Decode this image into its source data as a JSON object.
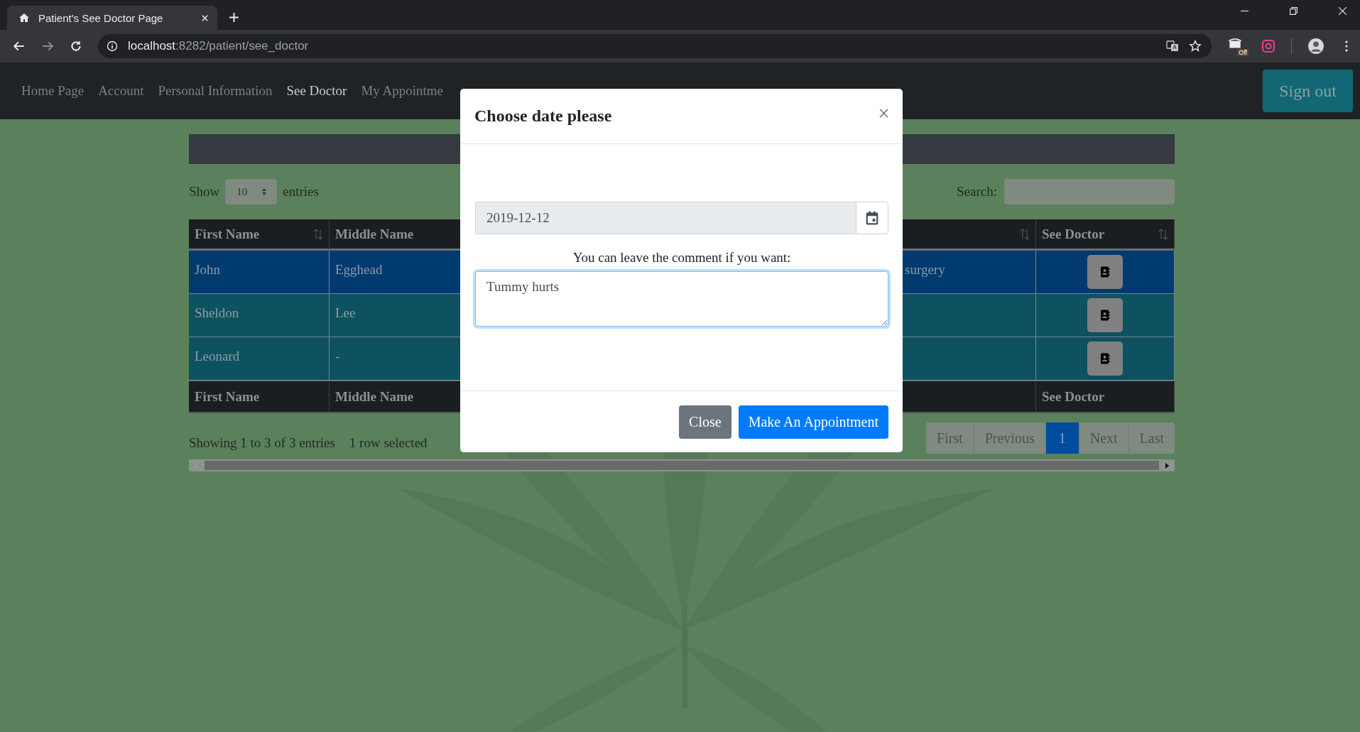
{
  "browser": {
    "tab_title": "Patient's See Doctor Page",
    "url_host": "localhost",
    "url_rest": ":8282/patient/see_doctor",
    "extension_badge": "Off"
  },
  "navbar": {
    "links": [
      {
        "label": "Home Page",
        "selected": false
      },
      {
        "label": "Account",
        "selected": false
      },
      {
        "label": "Personal Information",
        "selected": false
      },
      {
        "label": "See Doctor",
        "selected": true
      },
      {
        "label": "My Appointme",
        "selected": false
      }
    ],
    "sign_out": "Sign out"
  },
  "table_controls": {
    "show_label": "Show",
    "page_length": "10",
    "entries_label": "entries",
    "search_label": "Search:"
  },
  "table": {
    "columns": [
      {
        "label": "First Name",
        "footer": "First Name",
        "sortable": true
      },
      {
        "label": "Middle Name",
        "footer": "Middle Name",
        "sortable": false
      },
      {
        "sortable": true
      },
      {
        "label": "See Doctor",
        "footer": "See Doctor",
        "sortable": true
      }
    ],
    "rows": [
      {
        "first_name": "John",
        "middle_name": "Egghead",
        "column_3": "surgery",
        "selected": true
      },
      {
        "first_name": "Sheldon",
        "middle_name": "Lee",
        "selected": false
      },
      {
        "first_name": "Leonard",
        "middle_name": "-",
        "selected": false
      }
    ]
  },
  "info": "Showing 1 to 3 of 3 entries",
  "selection_info": "1 row selected",
  "pagination": [
    {
      "label": "First",
      "selected": false
    },
    {
      "label": "Previous",
      "selected": false
    },
    {
      "label": "1",
      "selected": true
    },
    {
      "label": "Next",
      "selected": false
    },
    {
      "label": "Last",
      "selected": false
    }
  ],
  "modal": {
    "title": "Choose date please",
    "date": "2019-12-12",
    "comment_label": "You can leave the comment if you want:",
    "comment": "Tummy hurts",
    "buttons": [
      {
        "label": "Close",
        "kind": "secondary"
      },
      {
        "label": "Make An Appointment",
        "kind": "primary"
      }
    ]
  }
}
